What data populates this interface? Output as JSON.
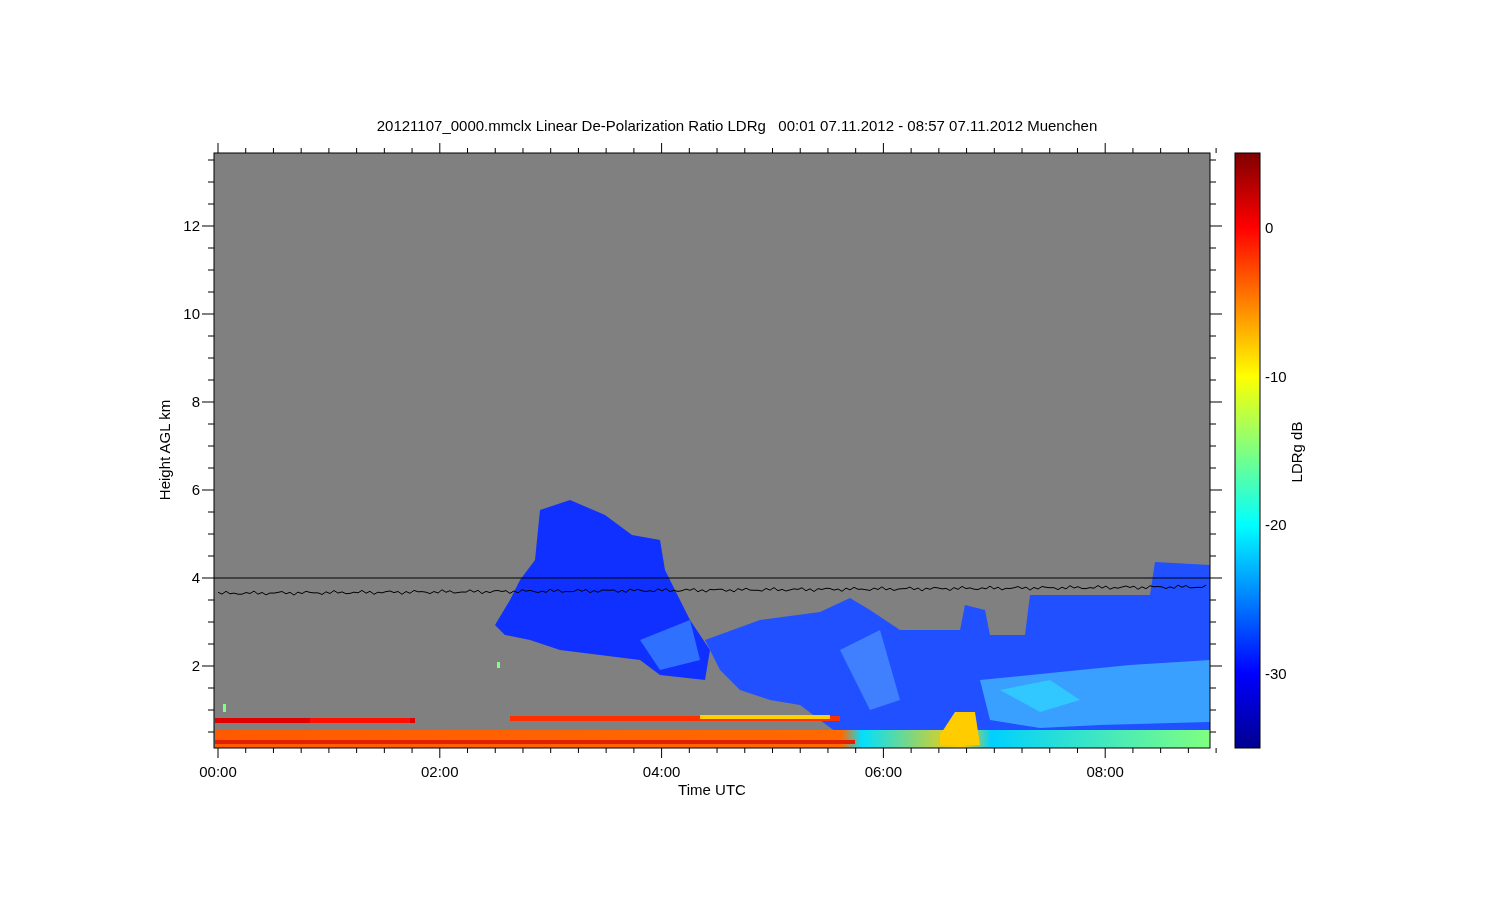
{
  "title": "20121107_0000.mmclx Linear De-Polarization Ratio LDRg   00:01 07.11.2012 - 08:57 07.11.2012 Muenchen",
  "y_axis": {
    "label": "Height AGL km",
    "ticks": [
      "12",
      "10",
      "8",
      "6",
      "4",
      "2"
    ]
  },
  "x_axis": {
    "label": "Time UTC",
    "ticks": [
      "00:00",
      "02:00",
      "04:00",
      "06:00",
      "08:00"
    ]
  },
  "colorbar": {
    "label": "LDRg dB",
    "ticks": [
      "0",
      "-10",
      "-20",
      "-30"
    ]
  }
}
